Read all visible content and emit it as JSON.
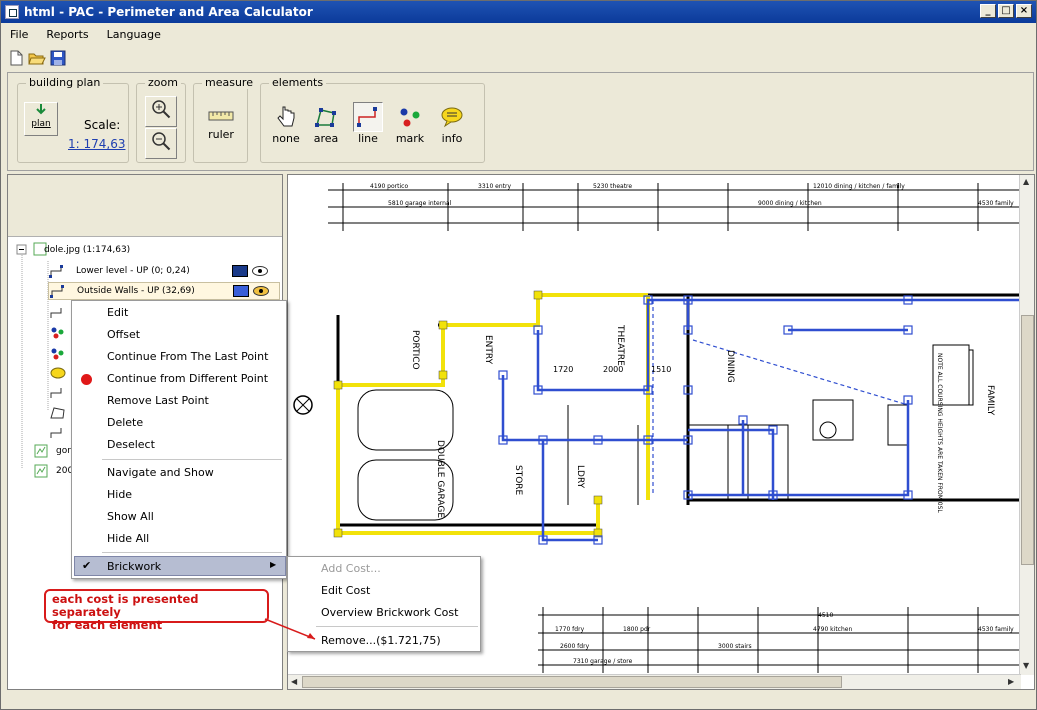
{
  "window": {
    "title": "html - PAC - Perimeter and Area Calculator"
  },
  "menubar": [
    "File",
    "Reports",
    "Language"
  ],
  "quickbar": {
    "icons": [
      "new-file-icon",
      "open-folder-icon",
      "save-icon"
    ]
  },
  "ribbon": {
    "building_plan": {
      "title": "building plan",
      "plan_label": "plan",
      "scale_label": "Scale:",
      "scale_value": "1: 174,63"
    },
    "zoom": {
      "title": "zoom"
    },
    "measure": {
      "title": "measure",
      "ruler_label": "ruler"
    },
    "elements": {
      "title": "elements",
      "buttons": [
        "none",
        "area",
        "line",
        "mark",
        "info"
      ]
    }
  },
  "tree": {
    "root": "dole.jpg (1:174,63)",
    "items": [
      {
        "label": "Lower level - UP (0; 0,24)",
        "color": "#1a3a8a"
      },
      {
        "label": "Outside Walls - UP (32,69)",
        "color": "#3a5fd8"
      }
    ],
    "bottom_items": [
      "gor",
      "200"
    ]
  },
  "context_menu": {
    "items": [
      "Edit",
      "Offset",
      "Continue From The Last Point",
      "Continue from Different Point",
      "Remove Last Point",
      "Delete",
      "Deselect",
      "Navigate and Show",
      "Hide",
      "Show All",
      "Hide All",
      "Brickwork"
    ]
  },
  "submenu": {
    "items": [
      "Add Cost...",
      "Edit Cost",
      "Overview Brickwork Cost",
      "Remove...($1.721,75)"
    ]
  },
  "callout": {
    "line1": "each cost is presented separately",
    "line2": "for each element"
  },
  "plan_labels": {
    "top_dims": [
      "4190 portico",
      "3310 entry",
      "5230 theatre",
      "12010 dining / kitchen / family"
    ],
    "top_dims2": [
      "5810 garage internal",
      "9000 dining / kitchen",
      "4530 family"
    ],
    "rooms": [
      "THEATRE",
      "DOUBLE GARAGE",
      "STORE",
      "LDRY",
      "DINING",
      "FAMILY",
      "ENTRY",
      "PORTICO"
    ],
    "inner_dims": [
      "1720",
      "2000",
      "1510"
    ],
    "bottom_dims": [
      "1770 fdry",
      "1800 pdr",
      "4790 kitchen",
      "4530 family",
      "2600 fdry",
      "3000 stairs",
      "7310 garage / store",
      "4510"
    ],
    "note": "NOTE ALL COURSING HEIGHTS ARE TAKEN FROM 0SL"
  }
}
